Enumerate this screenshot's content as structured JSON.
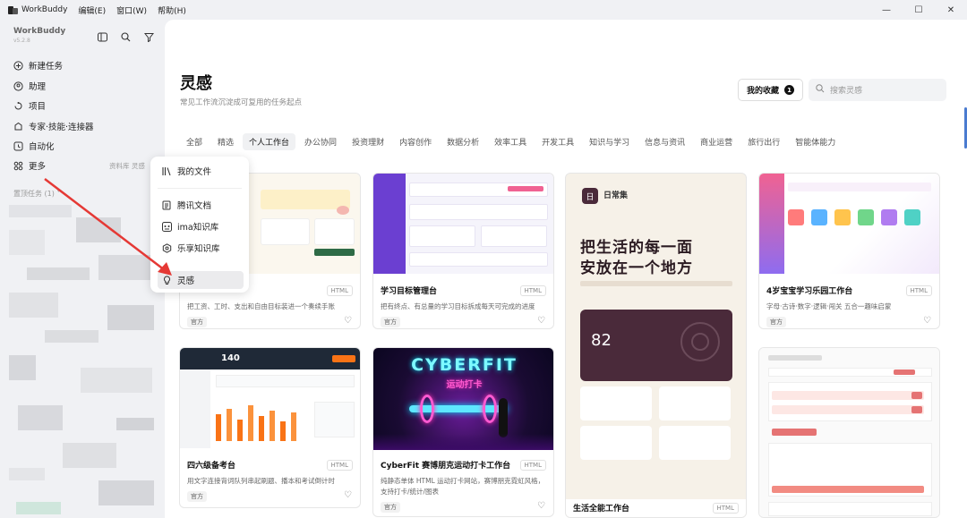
{
  "titlebar": {
    "app": "WorkBuddy",
    "menus": [
      "编辑(E)",
      "窗口(W)",
      "帮助(H)"
    ],
    "controls": [
      "—",
      "☐",
      "✕"
    ]
  },
  "sidebar": {
    "brand": "WorkBuddy",
    "version": "v5.2.8",
    "icons": [
      "panel-icon",
      "search-icon",
      "filter-icon"
    ],
    "items": [
      {
        "label": "新建任务",
        "icon": "plus-circle-icon"
      },
      {
        "label": "助理",
        "icon": "assistant-icon"
      },
      {
        "label": "项目",
        "icon": "project-icon"
      },
      {
        "label": "专家·技能·连接器",
        "icon": "expert-icon"
      },
      {
        "label": "自动化",
        "icon": "clock-icon"
      },
      {
        "label": "更多",
        "icon": "grid-icon"
      }
    ],
    "resource_hint": "资料库 灵感",
    "tasks_header": "置顶任务 (1) ˅"
  },
  "popup": {
    "items": [
      {
        "label": "我的文件",
        "icon": "folder-icon"
      },
      {
        "label": "腾讯文档",
        "icon": "doc-icon"
      },
      {
        "label": "ima知识库",
        "icon": "ima-icon"
      },
      {
        "label": "乐享知识库",
        "icon": "lexiang-icon"
      },
      {
        "label": "灵感",
        "icon": "bulb-icon",
        "selected": true
      }
    ]
  },
  "main": {
    "title": "灵感",
    "subtitle": "常见工作流沉淀成可复用的任务起点",
    "fav_label": "我的收藏",
    "fav_count": "1",
    "search_placeholder": "搜索灵感",
    "tabs": [
      "全部",
      "精选",
      "个人工作台",
      "办公协同",
      "投资理财",
      "内容创作",
      "数据分析",
      "效率工具",
      "开发工具",
      "知识与学习",
      "信息与资讯",
      "商业运营",
      "旅行出行",
      "智能体能力"
    ],
    "active_tab": 2
  },
  "cards": [
    {
      "title": "",
      "badge": "HTML",
      "desc": "把工资、工时、支出和自由目标装进一个奏续手账",
      "tag": "官方"
    },
    {
      "title": "学习目标管理台",
      "badge": "HTML",
      "desc": "把有终点、有总量的学习目标拆成每天可完成的进度",
      "tag": "官方"
    },
    {
      "title": "生活全能工作台",
      "badge": "HTML",
      "desc": "",
      "tag": "",
      "poster_name": "日常集",
      "poster_headline1": "把生活的每一面",
      "poster_headline2": "安放在一个地方",
      "poster_num": "82"
    },
    {
      "title": "4岁宝宝学习乐园工作台",
      "badge": "HTML",
      "desc": "字母·古诗·数字·逻辑·闯关 五合一趣味启蒙",
      "tag": "官方"
    },
    {
      "title": "四六级备考台",
      "badge": "HTML",
      "desc": "用文字连接背词队列串起刷题、播本和考试倒计时",
      "tag": "官方",
      "thumb_num": "140"
    },
    {
      "title": "CyberFit 赛博朋克运动打卡工作台",
      "badge": "HTML",
      "desc": "纯静态单体 HTML 运动打卡网站，赛博朋克霓虹风格，支持打卡/统计/图表",
      "tag": "官方",
      "poster_title": "CYBERFIT",
      "poster_sub": "运动打卡"
    },
    {
      "title": "",
      "badge": "",
      "desc": "",
      "tag": ""
    }
  ]
}
